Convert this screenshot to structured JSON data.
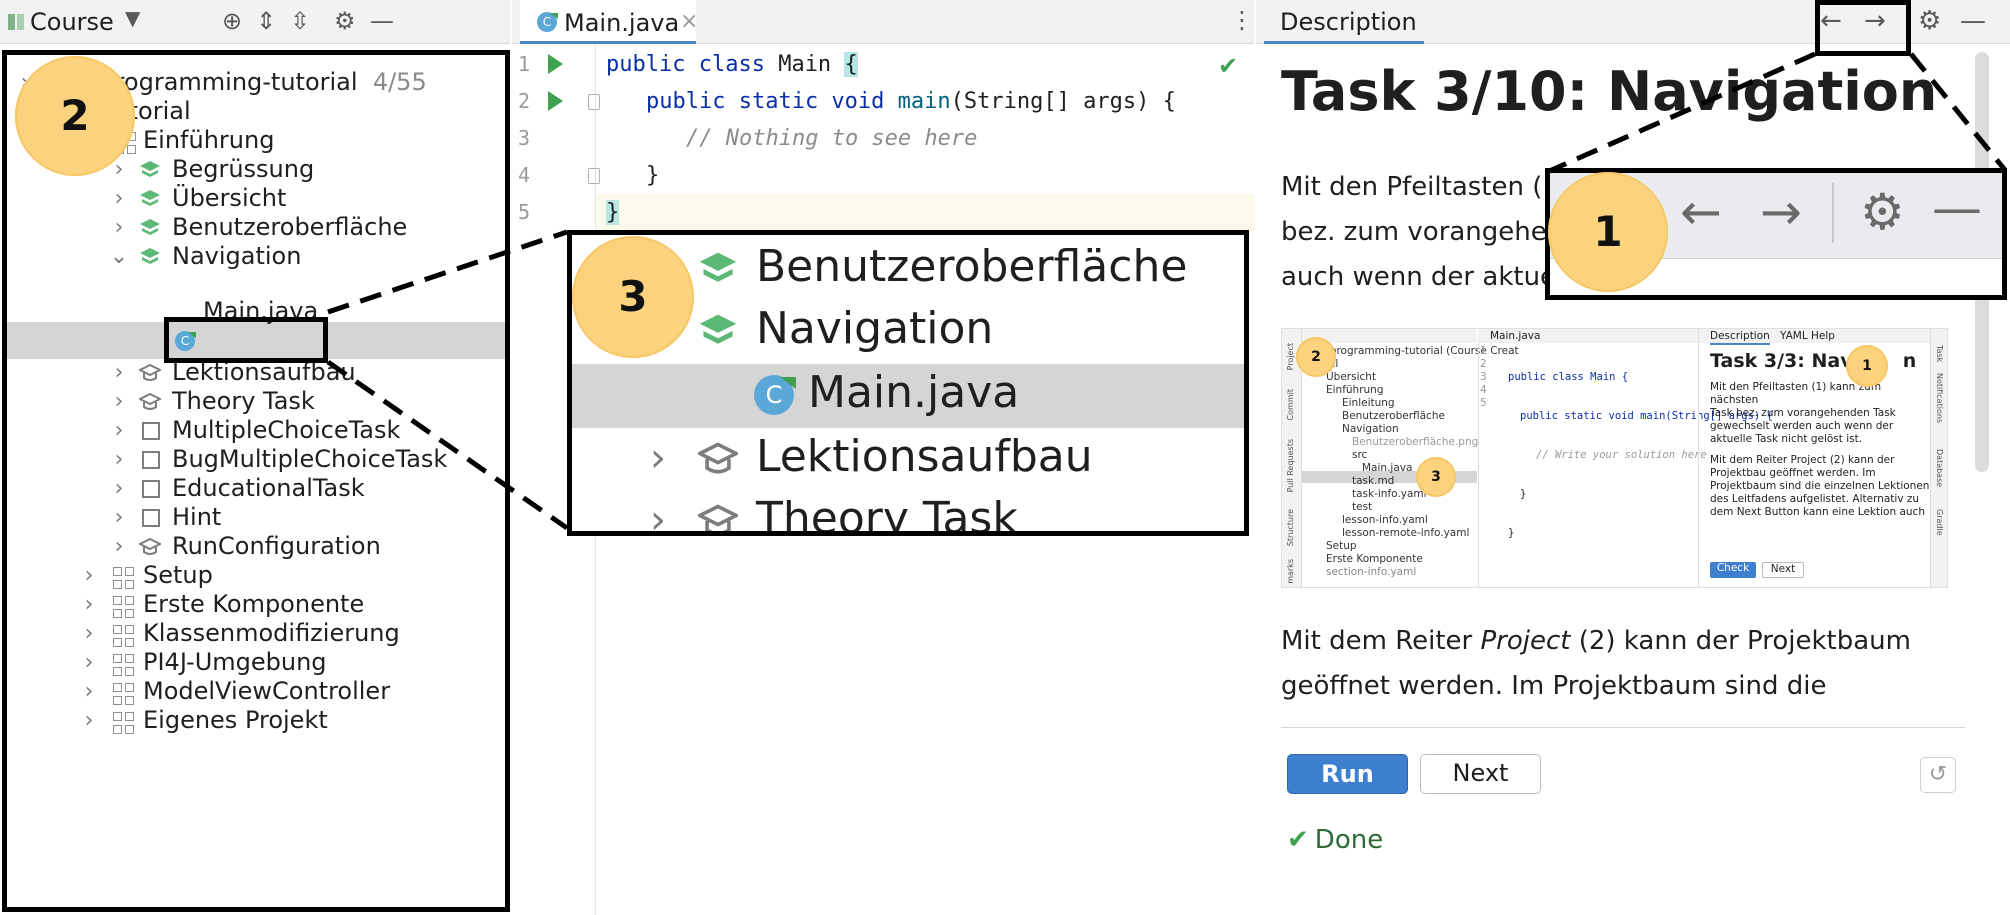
{
  "colors": {
    "accent": "#4a86c7",
    "run_green": "#3fa14f",
    "badge": "#fbd37e",
    "task_green": "#5cb876"
  },
  "project_panel": {
    "title": "Course",
    "root_label": "i-programming-tutorial",
    "root_count": "4/55",
    "items": [
      {
        "label": "tutorial",
        "icon": "none"
      },
      {
        "label": "Einführung",
        "icon": "lesson-grid-icon"
      },
      {
        "label": "Begrüssung",
        "icon": "task-solved-icon"
      },
      {
        "label": "Übersicht",
        "icon": "task-solved-icon"
      },
      {
        "label": "Benutzeroberfläche",
        "icon": "task-solved-icon"
      },
      {
        "label": "Navigation",
        "icon": "task-solved-icon"
      },
      {
        "label": "Main.java",
        "icon": "java-class-icon"
      },
      {
        "label": "Lektionsaufbau",
        "icon": "theory-task-icon"
      },
      {
        "label": "Theory Task",
        "icon": "theory-task-icon"
      },
      {
        "label": "MultipleChoiceTask",
        "icon": "task-square-icon"
      },
      {
        "label": "BugMultipleChoiceTask",
        "icon": "task-square-icon"
      },
      {
        "label": "EducationalTask",
        "icon": "task-square-icon"
      },
      {
        "label": "Hint",
        "icon": "task-square-icon"
      },
      {
        "label": "RunConfiguration",
        "icon": "theory-task-icon"
      },
      {
        "label": "Setup",
        "icon": "lesson-grid-icon"
      },
      {
        "label": "Erste Komponente",
        "icon": "lesson-grid-icon"
      },
      {
        "label": "Klassenmodifizierung",
        "icon": "lesson-grid-icon"
      },
      {
        "label": "PI4J-Umgebung",
        "icon": "lesson-grid-icon"
      },
      {
        "label": "ModelViewController",
        "icon": "lesson-grid-icon"
      },
      {
        "label": "Eigenes Projekt",
        "icon": "lesson-grid-icon"
      }
    ]
  },
  "editor": {
    "tab_label": "Main.java",
    "lines": [
      "1",
      "2",
      "3",
      "4",
      "5"
    ],
    "code": {
      "l1_kw": "public class",
      "l1_name": " Main ",
      "l1_brace": "{",
      "l2_kw": "public static void",
      "l2_fn": " main",
      "l2_rest": "(String[] args) {",
      "l3": "// Nothing to see here",
      "l4": "}",
      "l5": "}"
    }
  },
  "description": {
    "tab_label": "Description",
    "task_title": "Task 3/10: Navigation",
    "para1_lines": [
      "Mit den Pfeiltasten (",
      "bez. zum vorangehe",
      "auch wenn der aktue"
    ],
    "para2_html_parts": {
      "before": "Mit dem Reiter ",
      "emph": "Project",
      "after": " (2) kann der Projektbaum"
    },
    "para2_line2": "geöffnet werden. Im Projektbaum sind die",
    "run_label": "Run",
    "next_label": "Next",
    "done_label": "Done"
  },
  "zoom_callout_3": {
    "items": [
      "Benutzeroberfläche",
      "Navigation",
      "Main.java",
      "Lektionsaufbau",
      "Theory Task"
    ]
  },
  "badges": {
    "one": "1",
    "two": "2",
    "three": "3"
  },
  "mini_screenshot": {
    "project_tab": "Project",
    "left_tree": [
      "-programming-tutorial (Course Creat",
      "ial",
      "Übersicht",
      "Einführung",
      "Einleitung",
      "Benutzeroberfläche",
      "Navigation",
      "Benutzeroberfläche.png",
      "src",
      "Main.java",
      "task.md",
      "task-info.yaml",
      "test",
      "lesson-info.yaml",
      "lesson-remote-info.yaml",
      "Setup",
      "Erste Komponente",
      "section-info.yaml"
    ],
    "side_tabs": [
      "Project",
      "Commit",
      "Pull Requests",
      "Structure",
      "marks"
    ],
    "editor_tab": "Main.java",
    "code_l1": "public class Main {",
    "code_l2": "public static void main(String[] args) {",
    "code_l3": "// Write your solution here",
    "code_l4": "}",
    "code_l5": "}",
    "line_numbers": [
      "1",
      "2",
      "3",
      "4",
      "5"
    ],
    "desc_tabs": [
      "Description",
      "YAML Help"
    ],
    "task_title": "Task 3/3: Navig",
    "task_title_end": "n",
    "paragraphs": [
      "Mit den Pfeiltasten (1) kann zum nächsten",
      "Task bez. zum vorangehenden Task",
      "gewechselt werden auch wenn der",
      "aktuelle Task nicht gelöst ist.",
      "Mit dem Reiter Project (2) kann der",
      "Projektbau geöffnet werden. Im",
      "Projektbaum sind die einzelnen Lektionen",
      "des Leitfadens aufgelistet. Alternativ zu",
      "dem Next Button kann eine Lektion auch"
    ],
    "check_label": "Check",
    "next_label": "Next",
    "right_tabs": [
      "Task",
      "Notifications",
      "Database",
      "Gradle"
    ]
  }
}
